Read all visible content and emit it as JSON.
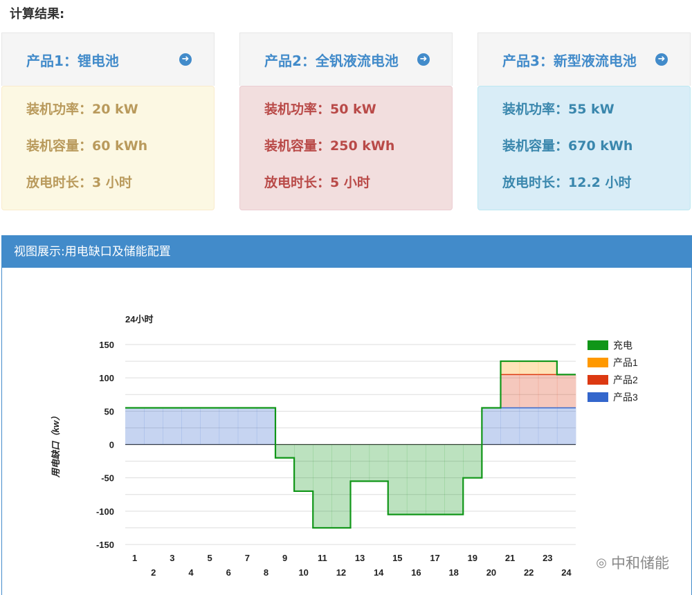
{
  "header": {
    "title": "计算结果:"
  },
  "products": [
    {
      "title": "产品1：锂电池",
      "rows": [
        "装机功率：20 kW",
        "装机容量：60 kWh",
        "放电时长：3 小时"
      ]
    },
    {
      "title": "产品2：全钒液流电池",
      "rows": [
        "装机功率：50 kW",
        "装机容量：250 kWh",
        "放电时长：5 小时"
      ]
    },
    {
      "title": "产品3：新型液流电池",
      "rows": [
        "装机功率：55 kW",
        "装机容量：670 kWh",
        "放电时长：12.2 小时"
      ]
    }
  ],
  "panel": {
    "title": "视图展示:用电缺口及储能配置"
  },
  "watermark": "中和储能",
  "chart_data": {
    "type": "area",
    "title": "24小时",
    "xlabel": "",
    "ylabel": "用电缺口（kw）",
    "categories": [
      "1",
      "2",
      "3",
      "4",
      "5",
      "6",
      "7",
      "8",
      "9",
      "10",
      "11",
      "12",
      "13",
      "14",
      "15",
      "16",
      "17",
      "18",
      "19",
      "20",
      "21",
      "22",
      "23",
      "24"
    ],
    "ylim": [
      -150,
      150
    ],
    "yticks": [
      150,
      100,
      50,
      0,
      -50,
      -100,
      -150
    ],
    "stacked": true,
    "step": true,
    "legend_position": "right",
    "series": [
      {
        "name": "充电",
        "color": "#109618",
        "values": [
          0,
          0,
          0,
          0,
          0,
          0,
          0,
          0,
          -20,
          -70,
          -125,
          -125,
          -55,
          -55,
          -105,
          -105,
          -105,
          -105,
          -50,
          0,
          0,
          0,
          0,
          0
        ]
      },
      {
        "name": "产品1",
        "color": "#ff9900",
        "values": [
          0,
          0,
          0,
          0,
          0,
          0,
          0,
          0,
          0,
          0,
          0,
          0,
          0,
          0,
          0,
          0,
          0,
          0,
          0,
          0,
          20,
          20,
          20,
          0
        ]
      },
      {
        "name": "产品2",
        "color": "#dc3912",
        "values": [
          0,
          0,
          0,
          0,
          0,
          0,
          0,
          0,
          0,
          0,
          0,
          0,
          0,
          0,
          0,
          0,
          0,
          0,
          0,
          0,
          50,
          50,
          50,
          50
        ]
      },
      {
        "name": "产品3",
        "color": "#3366cc",
        "values": [
          55,
          55,
          55,
          55,
          55,
          55,
          55,
          55,
          0,
          0,
          0,
          0,
          0,
          0,
          0,
          0,
          0,
          0,
          0,
          55,
          55,
          55,
          55,
          55
        ]
      }
    ],
    "total_line": {
      "color": "#109618",
      "values": [
        55,
        55,
        55,
        55,
        55,
        55,
        55,
        55,
        -20,
        -70,
        -125,
        -125,
        -55,
        -55,
        -105,
        -105,
        -105,
        -105,
        -50,
        55,
        125,
        125,
        125,
        105
      ]
    },
    "grid": true
  }
}
